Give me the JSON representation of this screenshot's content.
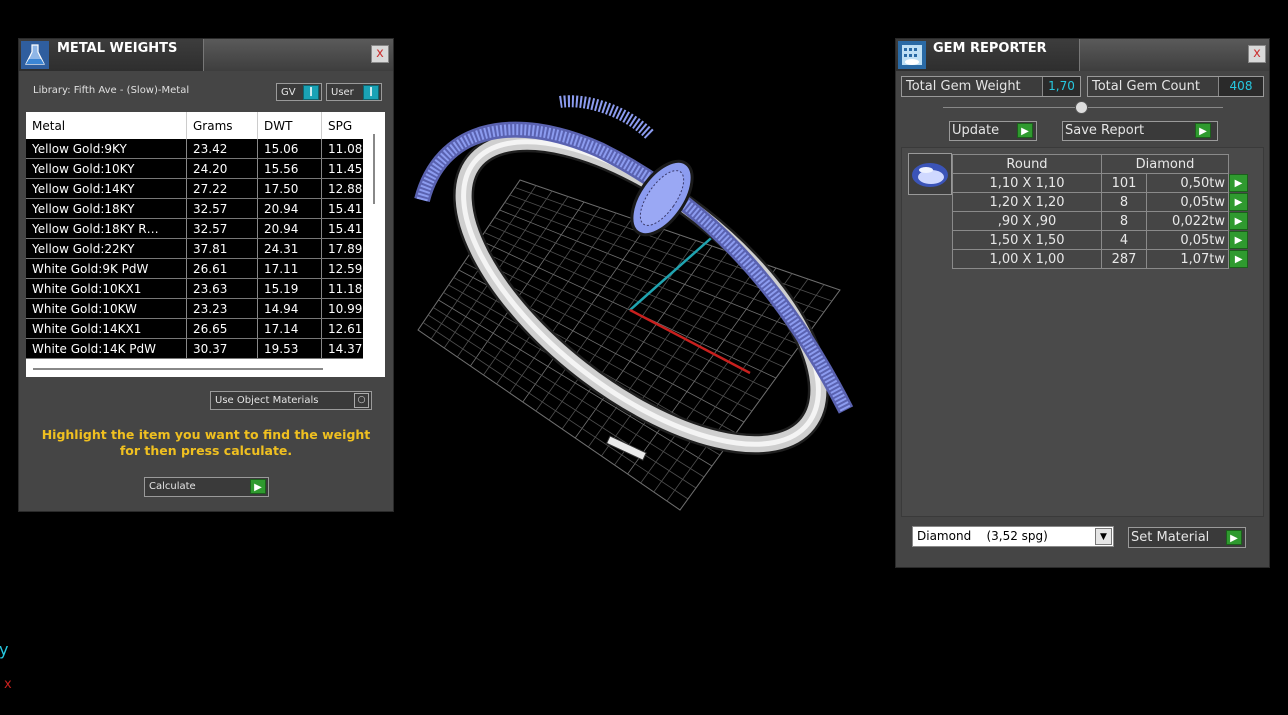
{
  "metal_weights": {
    "title": "METAL WEIGHTS",
    "close": "x",
    "library_label": "Library: Fifth Ave - (Slow)-Metal",
    "gv_label": "GV",
    "user_label": "User",
    "columns": [
      "Metal",
      "Grams",
      "DWT",
      "SPG"
    ],
    "rows": [
      [
        "Yellow Gold:9KY",
        "23.42",
        "15.06",
        "11.08"
      ],
      [
        "Yellow Gold:10KY",
        "24.20",
        "15.56",
        "11.45"
      ],
      [
        "Yellow Gold:14KY",
        "27.22",
        "17.50",
        "12.88"
      ],
      [
        "Yellow Gold:18KY",
        "32.57",
        "20.94",
        "15.41"
      ],
      [
        "Yellow Gold:18KY R…",
        "32.57",
        "20.94",
        "15.41"
      ],
      [
        "Yellow Gold:22KY",
        "37.81",
        "24.31",
        "17.89"
      ],
      [
        "White Gold:9K PdW",
        "26.61",
        "17.11",
        "12.59"
      ],
      [
        "White Gold:10KX1",
        "23.63",
        "15.19",
        "11.18"
      ],
      [
        "White Gold:10KW",
        "23.23",
        "14.94",
        "10.99"
      ],
      [
        "White Gold:14KX1",
        "26.65",
        "17.14",
        "12.61"
      ],
      [
        "White Gold:14K PdW",
        "30.37",
        "19.53",
        "14.37"
      ]
    ],
    "use_object_materials": "Use Object Materials",
    "hint": "Highlight the item you want to find the weight for then press calculate.",
    "calculate": "Calculate"
  },
  "gem_reporter": {
    "title": "GEM REPORTER",
    "close": "x",
    "total_weight_label": "Total Gem Weight",
    "total_weight_value": "1,70",
    "total_count_label": "Total Gem Count",
    "total_count_value": "408",
    "update": "Update",
    "save_report": "Save Report",
    "header": [
      "Round",
      "Diamond"
    ],
    "rows": [
      [
        "1,10 X 1,10",
        "101",
        "0,50tw"
      ],
      [
        "1,20 X 1,20",
        "8",
        "0,05tw"
      ],
      [
        ",90 X ,90",
        "8",
        "0,022tw"
      ],
      [
        "1,50 X 1,50",
        "4",
        "0,05tw"
      ],
      [
        "1,00 X 1,00",
        "287",
        "1,07tw"
      ]
    ],
    "material_select": "Diamond    (3,52 spg)",
    "set_material": "Set Material"
  },
  "axis_glyphs": {
    "y": "y",
    "x": "x"
  },
  "colors": {
    "accent_green": "#2f9a2f",
    "value_cyan": "#27c8e0",
    "hint_yellow": "#f0c020",
    "gem_blue": "#8c9cf0"
  }
}
